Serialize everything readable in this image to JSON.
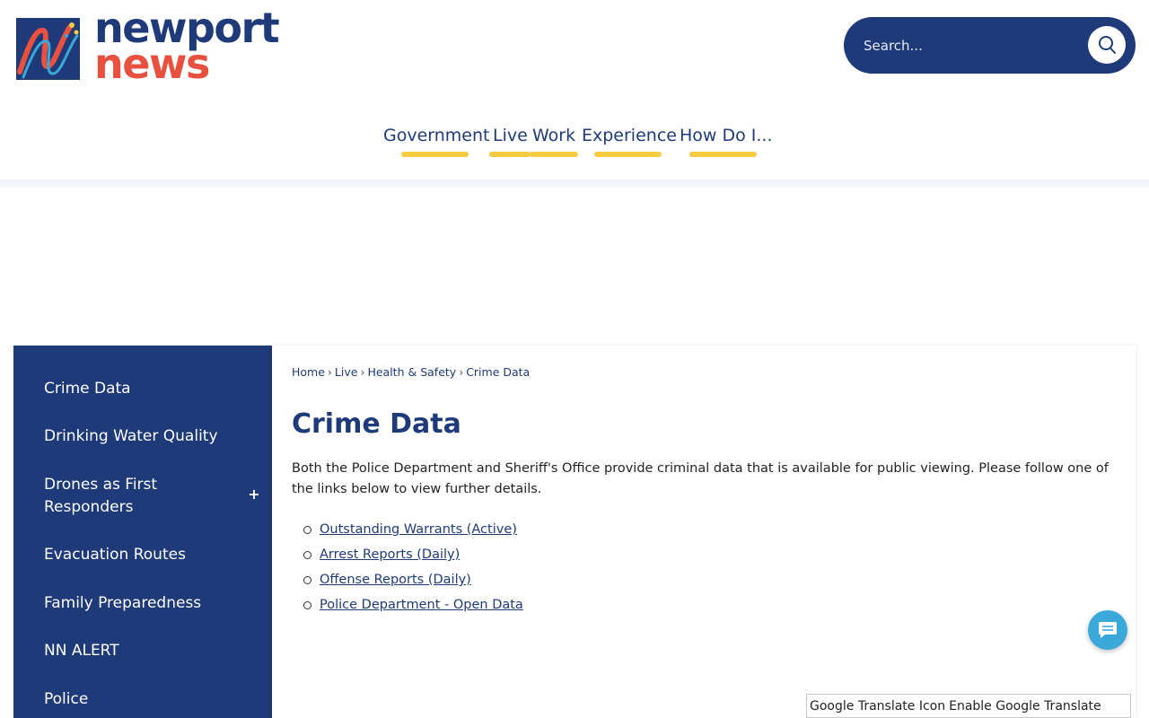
{
  "header": {
    "logo": {
      "line1": "newport",
      "line2": "news"
    },
    "search": {
      "placeholder": "Search..."
    },
    "nav": [
      {
        "label": "Government"
      },
      {
        "label": "Live"
      },
      {
        "label": "Work"
      },
      {
        "label": "Experience"
      },
      {
        "label": "How Do I..."
      }
    ]
  },
  "sidebar": {
    "items": [
      {
        "label": "Crime Data"
      },
      {
        "label": "Drinking Water Quality"
      },
      {
        "label": "Drones as First Responders"
      },
      {
        "label": "Evacuation Routes"
      },
      {
        "label": "Family Preparedness"
      },
      {
        "label": "NN ALERT"
      },
      {
        "label": "Police"
      }
    ],
    "toggle_symbol": "+"
  },
  "main": {
    "breadcrumb": [
      {
        "label": "Home"
      },
      {
        "label": "Live"
      },
      {
        "label": "Health & Safety"
      },
      {
        "label": "Crime Data"
      }
    ],
    "breadcrumb_separator": "›",
    "title": "Crime Data",
    "intro": "Both the Police Department and Sheriff's Office provide criminal data that is available for public viewing. Please follow one of the links below to view further details.",
    "links": [
      {
        "label": "Outstanding Warrants (Active)"
      },
      {
        "label": "Arrest Reports (Daily)"
      },
      {
        "label": "Offense Reports (Daily)"
      },
      {
        "label": "Police Department - Open Data"
      }
    ]
  },
  "translate": {
    "icon_alt": "Google Translate Icon",
    "label": "Enable Google Translate"
  },
  "colors": {
    "brand_navy": "#1f3a78",
    "brand_red": "#e8513f",
    "accent_yellow": "#f5cc42",
    "chat_blue": "#3aa8d8"
  },
  "icons": {
    "search": "search-icon",
    "chat": "chat-icon",
    "toggle": "plus-icon"
  }
}
